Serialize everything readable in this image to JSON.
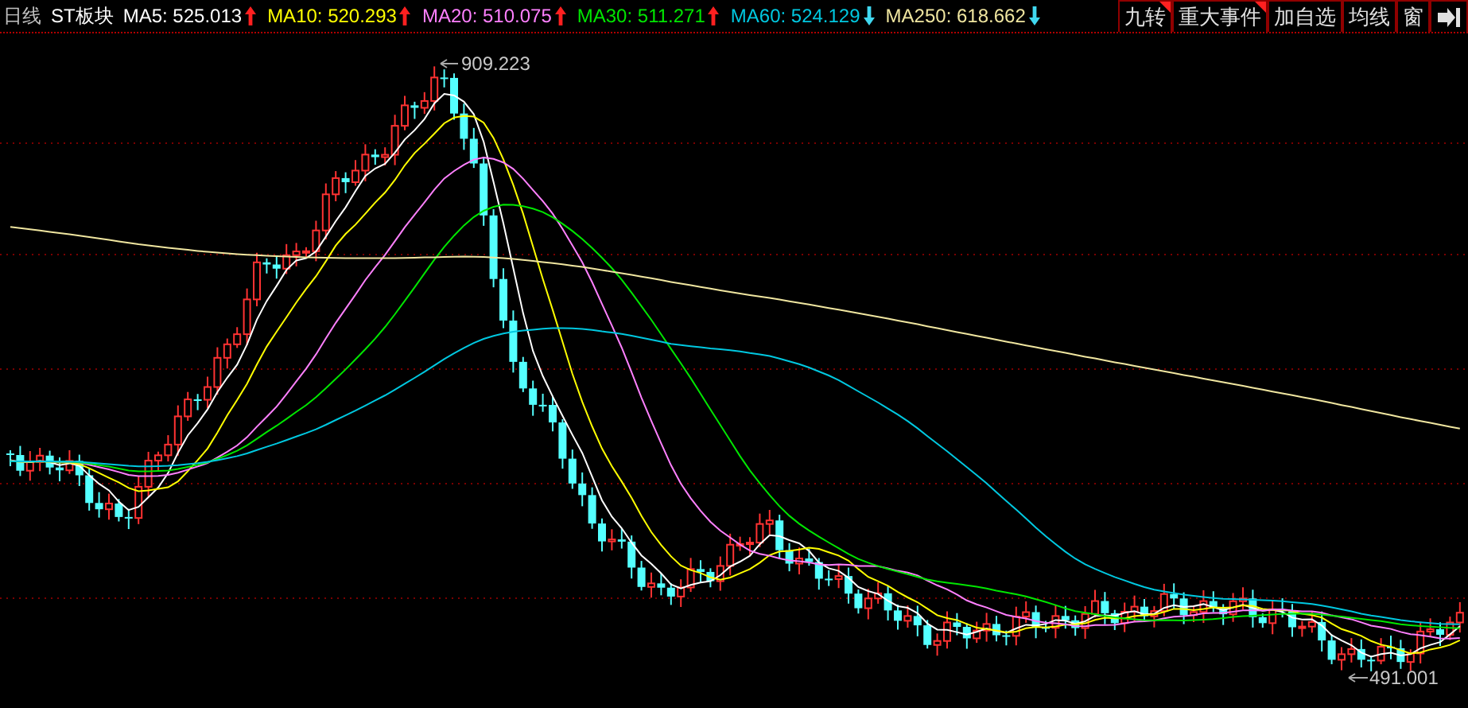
{
  "header": {
    "period": "日线",
    "name": "ST板块",
    "averages": [
      {
        "label": "MA5:",
        "value": "525.013",
        "rising": true,
        "color": "#ffffff"
      },
      {
        "label": "MA10:",
        "value": "520.293",
        "rising": true,
        "color": "#ffff00"
      },
      {
        "label": "MA20:",
        "value": "510.075",
        "rising": true,
        "color": "#ff80ff"
      },
      {
        "label": "MA30:",
        "value": "511.271",
        "rising": true,
        "color": "#00e600"
      },
      {
        "label": "MA60:",
        "value": "524.129",
        "rising": false,
        "color": "#00c8e0"
      },
      {
        "label": "MA250:",
        "value": "618.662",
        "rising": false,
        "color": "#f0e6a0"
      }
    ],
    "buttons": [
      {
        "label": "九转",
        "flagged": true
      },
      {
        "label": "重大事件",
        "flagged": true
      },
      {
        "label": "加自选",
        "flagged": false
      },
      {
        "label": "均线",
        "flagged": false
      },
      {
        "label": "窗",
        "flagged": false
      }
    ]
  },
  "chart": {
    "high_label": "909.223",
    "low_label": "491.001"
  }
}
